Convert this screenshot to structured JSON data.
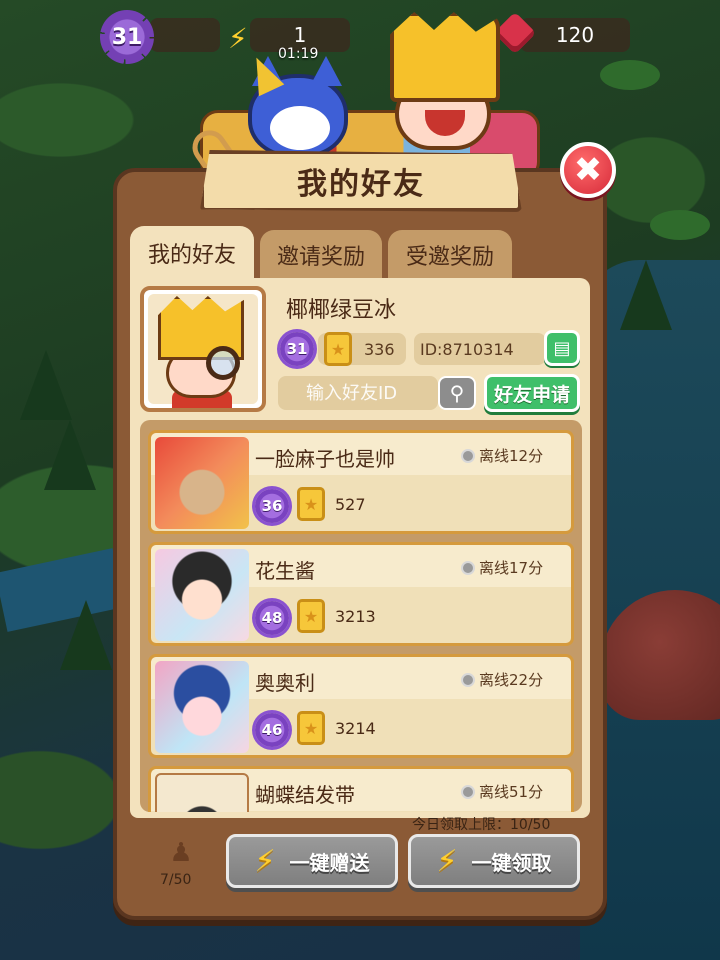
{
  "hud": {
    "level": "31",
    "energy": "1",
    "timer": "01:19",
    "gems": "120",
    "xp_text": ""
  },
  "dialog": {
    "title": "我的好友",
    "close_icon": "✖"
  },
  "tabs": [
    {
      "label": "我的好友",
      "active": true
    },
    {
      "label": "邀请奖励",
      "active": false
    },
    {
      "label": "受邀奖励",
      "active": false
    }
  ],
  "profile": {
    "name": "椰椰绿豆冰",
    "level": "31",
    "points": "336",
    "id": "ID:8710314",
    "copy_icon": "copy-icon"
  },
  "search": {
    "placeholder": "输入好友ID",
    "search_icon": "magnifier-icon",
    "apply_label": "好友申请"
  },
  "friends": [
    {
      "name": "一脸麻子也是帅",
      "status": "离线12分",
      "level": "36",
      "points": "527"
    },
    {
      "name": "花生酱",
      "status": "离线17分",
      "level": "48",
      "points": "3213"
    },
    {
      "name": "奥奥利",
      "status": "离线22分",
      "level": "46",
      "points": "3214"
    },
    {
      "name": "蝴蝶结发带",
      "status": "离线51分",
      "level": "",
      "points": ""
    }
  ],
  "footer": {
    "daily_limit": "今日领取上限：10/50",
    "friend_count": "7/50",
    "send_all_label": "一键赠送",
    "claim_all_label": "一键领取"
  },
  "colors": {
    "panel": "#8b5a36",
    "content": "#f3e2bd",
    "accent_green": "#3fbf6a",
    "close_red": "#d62b3a",
    "level_purple": "#7a42c0"
  }
}
